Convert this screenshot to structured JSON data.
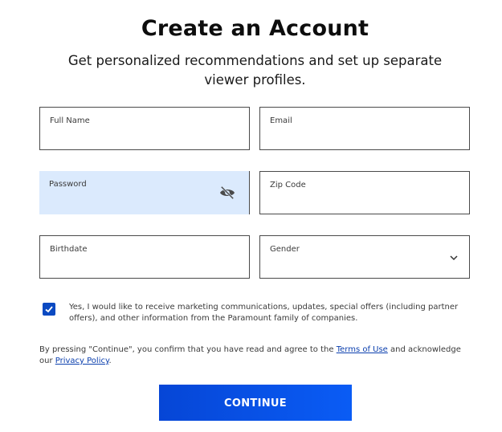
{
  "header": {
    "title": "Create an Account",
    "subtitle": "Get personalized recommendations and set up separate viewer profiles."
  },
  "form": {
    "full_name": {
      "label": "Full Name",
      "value": ""
    },
    "email": {
      "label": "Email",
      "value": ""
    },
    "password": {
      "label": "Password",
      "value": "",
      "toggle_icon": "eye-off-icon"
    },
    "zip_code": {
      "label": "Zip Code",
      "value": ""
    },
    "birthdate": {
      "label": "Birthdate",
      "value": ""
    },
    "gender": {
      "label": "Gender",
      "value": "",
      "icon": "chevron-down-icon"
    }
  },
  "consent": {
    "checked": true,
    "text": "Yes, I would like to receive marketing communications, updates, special offers (including partner offers), and other information from the Paramount family of companies."
  },
  "legal": {
    "prefix": "By pressing \"Continue\", you confirm that you have read and agree to the ",
    "terms_link": "Terms of Use",
    "middle": " and acknowledge our ",
    "privacy_link": "Privacy Policy",
    "suffix": "."
  },
  "actions": {
    "continue_label": "CONTINUE"
  },
  "colors": {
    "accent": "#0a4fe0",
    "password_fill": "#dbeafd",
    "link": "#0b3fae"
  }
}
